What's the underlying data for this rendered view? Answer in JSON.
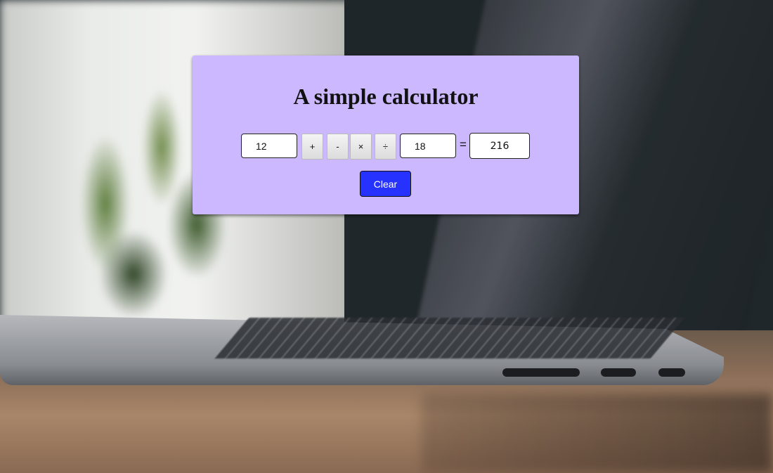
{
  "calculator": {
    "title": "A simple calculator",
    "operand1": "12",
    "operand2": "18",
    "result": "216",
    "operators": {
      "add": "+",
      "subtract": "-",
      "multiply": "×",
      "divide": "÷"
    },
    "equals": "=",
    "clear_label": "Clear"
  },
  "colors": {
    "card_background": "#cbb8ff",
    "clear_button": "#2632ff"
  }
}
